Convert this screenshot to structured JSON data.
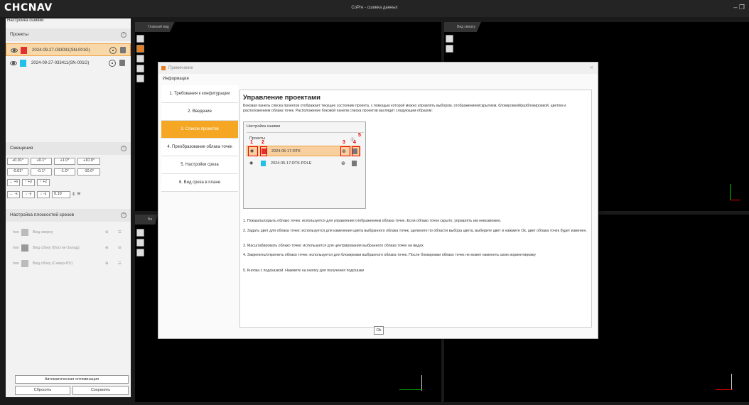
{
  "app": {
    "logo": "CHCNAV",
    "title": "CoPre - сшивка данных",
    "controls": "– ❐"
  },
  "left": {
    "panel_title": "Настройка сшивки",
    "projects_header": "Проекты",
    "projects": [
      {
        "name": "2024-09-27-033031(SN-001G)",
        "color": "#e03030",
        "selected": true
      },
      {
        "name": "2024-09-27-033411(SN-001G)",
        "color": "#20c0e8",
        "selected": false
      }
    ],
    "offsets_header": "Смещения",
    "offset_rot": [
      "+0.01°",
      "+0.1°",
      "+1.0°",
      "+10.0°",
      "-0.01°",
      "-0.1°",
      "-1.0°",
      "-10.0°"
    ],
    "offset_axes": [
      "→ +x",
      "↑ +y",
      "↑ +z",
      "← -x",
      "↓ -y",
      "↓ -z"
    ],
    "step_value": "0.10",
    "step_unit": "м",
    "slice_header": "Настройка плоскостей срезов",
    "slices": [
      {
        "toggle": "hon",
        "name": "Вид сверху"
      },
      {
        "toggle": "hon",
        "name": "Вид сбоку (Восток-Запад)"
      },
      {
        "toggle": "hon",
        "name": "Вид сбоку (Север-Юг)"
      }
    ],
    "auto_opt": "Автоматическая оптимизация",
    "reset": "Сбросить",
    "save": "Сохранить"
  },
  "views": {
    "main": "Главный вид",
    "top": "Вид сверху",
    "side": "Ви"
  },
  "dialog": {
    "title": "Примечание",
    "info": "Информация",
    "nav": [
      "1. Требования к конфигурации",
      "2. Введение",
      "3. Список проектов",
      "4. Преобразование облака точек",
      "5. Настройки среза",
      "6. Вид среза в плане"
    ],
    "active_index": 2,
    "heading": "Управление проектами",
    "intro": "Боковая панель списка проектов отображает текущее состояние проекта, с помощью которой можно управлять выбором, отображением/скрытием, блокировкой/разблокировкой, цветом и расположением облака точек. Расположение боковой панели списка проектов выглядит следующим образом:",
    "mini_title": "Настройка сшивки",
    "mini_projects": "Проекты",
    "mini_items": [
      {
        "name": "2024-05-17-RTK",
        "color": "#e03030"
      },
      {
        "name": "2024-05-17-RTK-POLE",
        "color": "#20c0e8"
      }
    ],
    "markers": [
      "1",
      "2",
      "3",
      "4",
      "5"
    ],
    "paragraphs": [
      "1. Показать/скрыть облако точек: используется для управления отображением облака точек. Если облако точек скрыто, управлять им невозможно.",
      "2. Задать цвет для облака точек: используется для изменения цвета выбранного облака точек, щелкните по области выбора цвета, выберите цвет и нажмите Ок, цвет облака точек будет изменен.",
      "3. Масштабировать облако точек: используется для центрирования выбранного облака точек на видах",
      "4. Закрепить/открепить облако точек: используется для блокировки выбранного облака точек. После блокировки облако точек не может изменять свою иориентировку",
      "5. Кнопка с подсказкой. Нажмите на кнопку для получения подсказки"
    ],
    "ok": "Ok"
  }
}
